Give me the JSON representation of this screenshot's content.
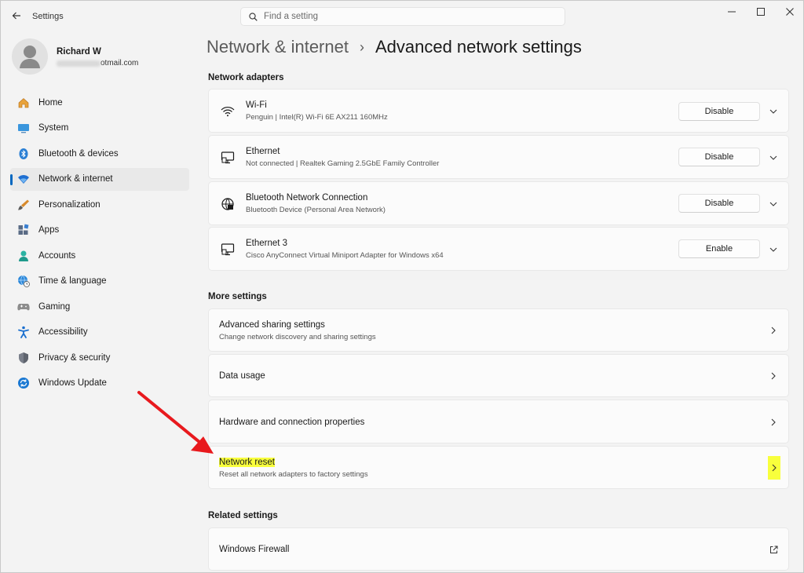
{
  "window": {
    "app_title": "Settings",
    "search_placeholder": "Find a setting"
  },
  "profile": {
    "name": "Richard W",
    "email_visible": "otmail.com"
  },
  "sidebar": {
    "items": [
      {
        "label": "Home",
        "icon": "home-icon"
      },
      {
        "label": "System",
        "icon": "monitor-icon"
      },
      {
        "label": "Bluetooth & devices",
        "icon": "bluetooth-icon"
      },
      {
        "label": "Network & internet",
        "icon": "wifi-icon",
        "active": true
      },
      {
        "label": "Personalization",
        "icon": "brush-icon"
      },
      {
        "label": "Apps",
        "icon": "apps-icon"
      },
      {
        "label": "Accounts",
        "icon": "person-icon"
      },
      {
        "label": "Time & language",
        "icon": "globe-clock-icon"
      },
      {
        "label": "Gaming",
        "icon": "gamepad-icon"
      },
      {
        "label": "Accessibility",
        "icon": "accessibility-icon"
      },
      {
        "label": "Privacy & security",
        "icon": "shield-icon"
      },
      {
        "label": "Windows Update",
        "icon": "update-icon"
      }
    ]
  },
  "breadcrumb": {
    "parent": "Network & internet",
    "separator": "›",
    "current": "Advanced network settings"
  },
  "sections": {
    "adapters_title": "Network adapters",
    "more_title": "More settings",
    "related_title": "Related settings"
  },
  "adapters": [
    {
      "name": "Wi-Fi",
      "detail": "Penguin | Intel(R) Wi-Fi 6E AX211 160MHz",
      "button": "Disable",
      "icon": "wifi-icon"
    },
    {
      "name": "Ethernet",
      "detail": "Not connected | Realtek Gaming 2.5GbE Family Controller",
      "button": "Disable",
      "icon": "ethernet-icon"
    },
    {
      "name": "Bluetooth Network Connection",
      "detail": "Bluetooth Device (Personal Area Network)",
      "button": "Disable",
      "icon": "globe-network-icon"
    },
    {
      "name": "Ethernet 3",
      "detail": "Cisco AnyConnect Virtual Miniport Adapter for Windows x64",
      "button": "Enable",
      "icon": "ethernet-icon"
    }
  ],
  "more_settings": [
    {
      "title": "Advanced sharing settings",
      "subtitle": "Change network discovery and sharing settings"
    },
    {
      "title": "Data usage",
      "subtitle": ""
    },
    {
      "title": "Hardware and connection properties",
      "subtitle": ""
    },
    {
      "title": "Network reset",
      "subtitle": "Reset all network adapters to factory settings",
      "highlighted": true
    }
  ],
  "related_settings": [
    {
      "title": "Windows Firewall",
      "icon": "external-link-icon"
    }
  ],
  "colors": {
    "accent": "#0067c0",
    "highlight": "#f8ff3c",
    "annotation_arrow": "#e8191d"
  }
}
